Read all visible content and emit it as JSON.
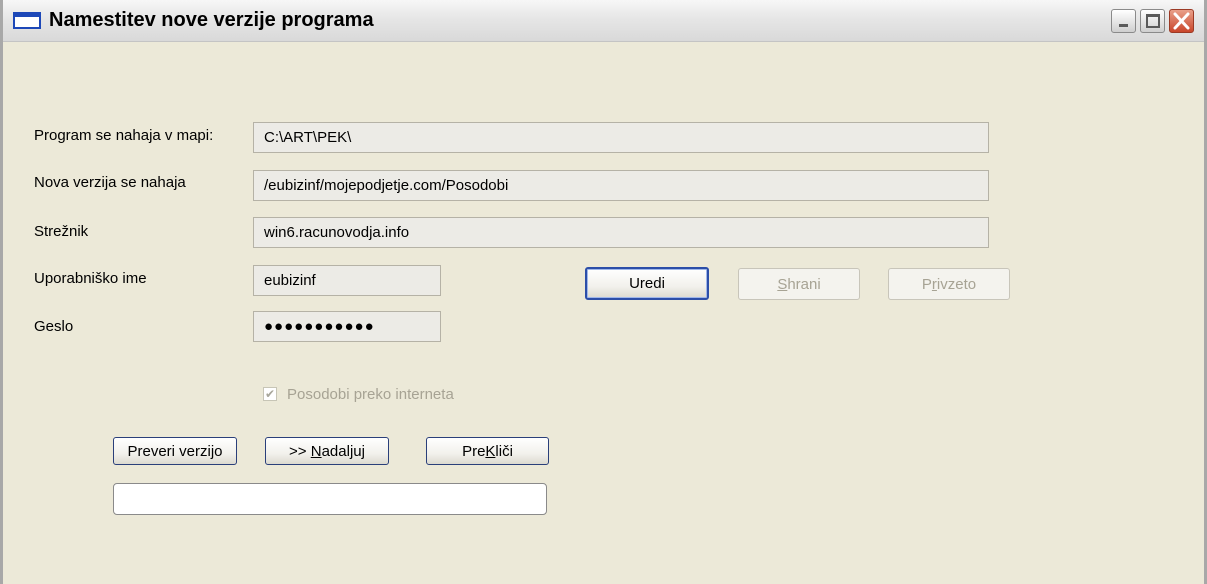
{
  "window": {
    "title": "Namestitev nove verzije programa"
  },
  "form": {
    "program_label": "Program se nahaja v mapi:",
    "program_value": "C:\\ART\\PEK\\",
    "new_version_label": "Nova verzija se nahaja",
    "new_version_value": "/eubizinf/mojepodjetje.com/Posodobi",
    "server_label": "Strežnik",
    "server_value": "win6.racunovodja.info",
    "username_label": "Uporabniško ime",
    "username_value": "eubizinf",
    "password_label": "Geslo",
    "password_value": "●●●●●●●●●●●"
  },
  "buttons": {
    "edit_label": "Uredi",
    "save_label_pre": "",
    "save_label_mnemonic": "S",
    "save_label_post": "hrani",
    "default_label_pre": "P",
    "default_label_mnemonic": "r",
    "default_label_post": "ivzeto",
    "check_version_label": "Preveri verzijo",
    "continue_label_pre": ">> ",
    "continue_label_mnemonic": "N",
    "continue_label_post": "adaljuj",
    "cancel_label_pre": "Pre",
    "cancel_label_mnemonic": "K",
    "cancel_label_post": "liči"
  },
  "options": {
    "update_internet_label": "Posodobi preko interneta",
    "update_internet_checked": true
  },
  "progress": {
    "value": 0
  },
  "colors": {
    "window_bg": "#ece9d8",
    "disabled_text": "#a7a394",
    "button_border": "#2a3f7a"
  }
}
